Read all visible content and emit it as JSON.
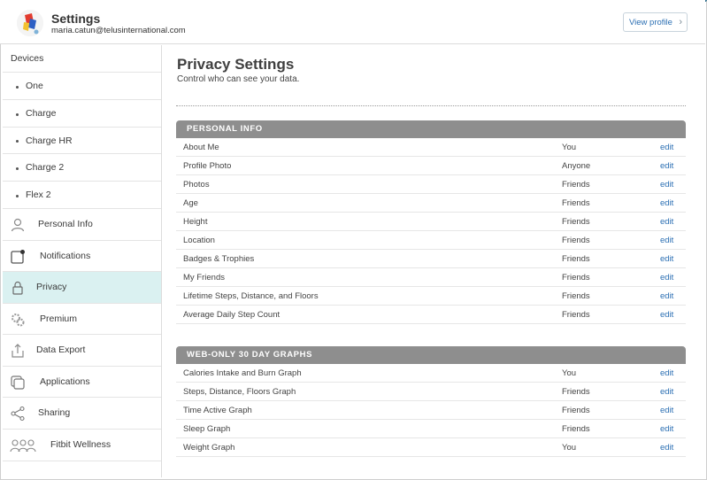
{
  "header": {
    "title": "Settings",
    "email": "maria.catun@telusinternational.com",
    "view_profile_label": "View profile"
  },
  "sidebar": {
    "devices_label": "Devices",
    "devices": [
      "One",
      "Charge",
      "Charge HR",
      "Charge 2",
      "Flex 2"
    ],
    "items": [
      {
        "label": "Personal Info",
        "icon": "person-icon"
      },
      {
        "label": "Notifications",
        "icon": "notification-icon"
      },
      {
        "label": "Privacy",
        "icon": "lock-icon",
        "selected": true
      },
      {
        "label": "Premium",
        "icon": "premium-gear-icon"
      },
      {
        "label": "Data Export",
        "icon": "export-icon"
      },
      {
        "label": "Applications",
        "icon": "applications-icon"
      },
      {
        "label": "Sharing",
        "icon": "share-icon"
      },
      {
        "label": "Fitbit Wellness",
        "icon": "group-icon"
      }
    ]
  },
  "main": {
    "title": "Privacy Settings",
    "subtitle": "Control who can see your data.",
    "sections": [
      {
        "title": "PERSONAL INFO",
        "rows": [
          {
            "label": "About Me",
            "value": "You",
            "action": "edit"
          },
          {
            "label": "Profile Photo",
            "value": "Anyone",
            "action": "edit"
          },
          {
            "label": "Photos",
            "value": "Friends",
            "action": "edit"
          },
          {
            "label": "Age",
            "value": "Friends",
            "action": "edit"
          },
          {
            "label": "Height",
            "value": "Friends",
            "action": "edit"
          },
          {
            "label": "Location",
            "value": "Friends",
            "action": "edit"
          },
          {
            "label": "Badges & Trophies",
            "value": "Friends",
            "action": "edit"
          },
          {
            "label": "My Friends",
            "value": "Friends",
            "action": "edit"
          },
          {
            "label": "Lifetime Steps, Distance, and Floors",
            "value": "Friends",
            "action": "edit"
          },
          {
            "label": "Average Daily Step Count",
            "value": "Friends",
            "action": "edit"
          }
        ]
      },
      {
        "title": "WEB-ONLY 30 DAY GRAPHS",
        "rows": [
          {
            "label": "Calories Intake and Burn Graph",
            "value": "You",
            "action": "edit"
          },
          {
            "label": "Steps, Distance, Floors Graph",
            "value": "Friends",
            "action": "edit"
          },
          {
            "label": "Time Active Graph",
            "value": "Friends",
            "action": "edit"
          },
          {
            "label": "Sleep Graph",
            "value": "Friends",
            "action": "edit"
          },
          {
            "label": "Weight Graph",
            "value": "You",
            "action": "edit"
          }
        ]
      }
    ]
  },
  "colors": {
    "accent_link": "#2b6fb3",
    "section_header": "#8e8e8e",
    "selected_bg": "#daf1f1"
  }
}
